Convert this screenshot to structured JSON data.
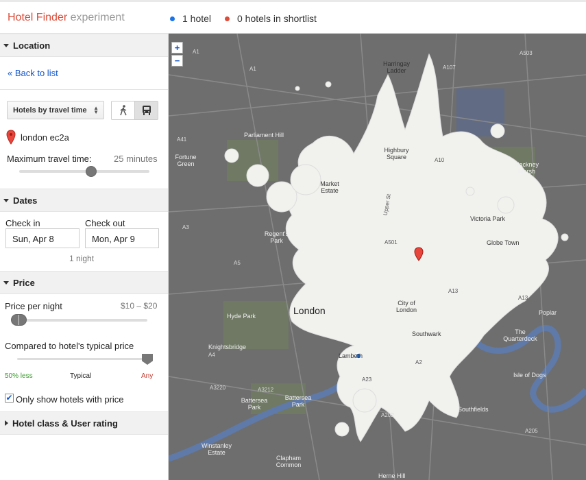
{
  "header": {
    "brand_name": "Hotel Finder",
    "brand_suffix": "experiment",
    "hotels_count": "1 hotel",
    "shortlist_count": "0 hotels in shortlist",
    "hotel_dot_color": "#1a73e8",
    "shortlist_dot_color": "#dd4b39"
  },
  "location": {
    "title": "Location",
    "back_link": "« Back to list",
    "search_mode": "Hotels by travel time",
    "walk_icon": "walking-person-icon",
    "transit_icon": "bus-icon",
    "place": "london ec2a",
    "max_time_label": "Maximum travel time:",
    "max_time_value": "25 minutes",
    "max_time_level": 0.59
  },
  "dates": {
    "title": "Dates",
    "checkin_label": "Check in",
    "checkout_label": "Check out",
    "checkin_value": "Sun, Apr 8",
    "checkout_value": "Mon, Apr 9",
    "nights": "1 night"
  },
  "price": {
    "title": "Price",
    "per_night_label": "Price per night",
    "per_night_range": "$10 – $20",
    "typical_label": "Compared to hotel's typical price",
    "scale_low": "50% less",
    "scale_mid": "Typical",
    "scale_high": "Any",
    "only_with_price": "Only show hotels with price",
    "only_with_price_checked": true
  },
  "hotel_class": {
    "title": "Hotel class & User rating"
  },
  "map": {
    "zoom_in": "+",
    "zoom_out": "−",
    "labels": {
      "harringay": "Harringay Ladder",
      "parliament_hill": "Parliament Hill",
      "fortune_green": "Fortune Green",
      "highbury": "Highbury Square",
      "hackney": "Hackney Marsh",
      "market_estate": "Market Estate",
      "victoria_park": "Victoria Park",
      "globe_town": "Globe Town",
      "regents_park": "Regent's Park",
      "city": "City of London",
      "hyde_park": "Hyde Park",
      "london": "London",
      "southwark": "Southwark",
      "knightsbridge": "Knightsbridge",
      "lambeth": "Lambeth",
      "the_quarterdeck": "The Quarterdeck",
      "poplar": "Poplar",
      "isle_of_dogs": "Isle of Dogs",
      "battersea_park_1": "Battersea Park",
      "battersea_park_2": "Battersea Park",
      "southfields": "Southfields",
      "winstanley": "Winstanley Estate",
      "clapham": "Clapham Common",
      "herne_hill": "Herne Hill",
      "upper_st": "Upper St"
    },
    "roads": {
      "a1a": "A1",
      "a1b": "A1",
      "a41": "A41",
      "a503": "A503",
      "a10": "A10",
      "a107": "A107",
      "a501": "A501",
      "a13a": "A13",
      "a13b": "A13",
      "a4": "A4",
      "a3212": "A3212",
      "a3220": "A3220",
      "a23a": "A23",
      "a202": "A202",
      "a2": "A2",
      "a205": "A205",
      "a3": "A3",
      "a5": "A5"
    }
  }
}
